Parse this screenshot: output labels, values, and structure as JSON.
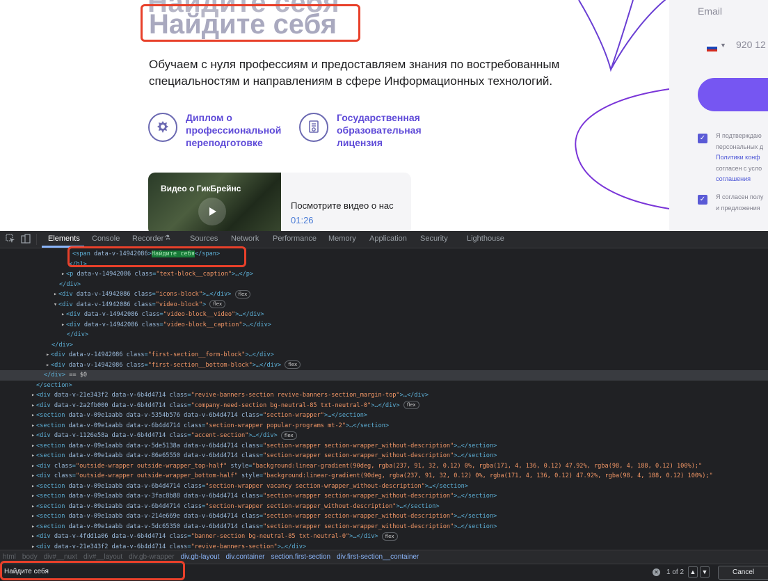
{
  "webpage": {
    "heading": "Найдите себя",
    "heading_above_cut": "Найдите себя",
    "caption_line1": "Обучаем с нуля профессиям и предоставляем знания по востребованным",
    "caption_line2": "специальностям и направлениям в сфере Информационных технологий.",
    "icons": [
      {
        "icon": "emblem-icon",
        "line1": "Диплом о",
        "line2": "профессиональной",
        "line3": "переподготовке"
      },
      {
        "icon": "license-certificate-icon",
        "line1": "Государственная",
        "line2": "образовательная",
        "line3": "лицензия"
      }
    ],
    "video": {
      "thumb_title": "Видео о ГикБрейнс",
      "caption": "Посмотрите видео о нас",
      "duration": "01:26"
    },
    "form": {
      "email_placeholder": "Email",
      "phone_placeholder": "920 12",
      "consent1": [
        "Я подтверждаю",
        "персональных д",
        "Политики конф",
        "согласен с усло",
        "соглашения"
      ],
      "consent2": [
        "Я согласен полу",
        "и предложения"
      ]
    }
  },
  "devtools": {
    "tabs": [
      "Elements",
      "Console",
      "Recorder",
      "Sources",
      "Network",
      "Performance",
      "Memory",
      "Application",
      "Security",
      "Lighthouse"
    ],
    "active_tab": "Elements",
    "recorder_icon": "flask-icon",
    "search": {
      "query": "Найдите себя",
      "match_count": "1 of 2",
      "cancel": "Cancel"
    },
    "breadcrumbs": [
      "html",
      "body",
      "div#__nuxt",
      "div#__layout",
      "div.gb-wrapper",
      "div.gb-layout",
      "div.container",
      "section.first-section",
      "div.first-section__container"
    ],
    "tree": {
      "l1": {
        "open": "<span ",
        "attr": "data-v-14942086",
        "gt": ">",
        "text": "Найдите себя",
        "close": "</span>"
      },
      "l2": "</h1>",
      "l3": {
        "open": "<p ",
        "attrs": "data-v-14942086 ",
        "cls_name": "class",
        "cls_val": "\"text-block__caption\"",
        "end": ">…</p>"
      },
      "l4": "</div>",
      "l5": {
        "open": "<div ",
        "attrs": "data-v-14942086 ",
        "cls_name": "class",
        "cls_val": "\"icons-block\"",
        "end": ">…</div>",
        "badge": "flex"
      },
      "l6": {
        "open": "<div ",
        "attrs": "data-v-14942086 ",
        "cls_name": "class",
        "cls_val": "\"video-block\"",
        "end": ">",
        "badge": "flex"
      },
      "l7": {
        "open": "<div ",
        "attrs": "data-v-14942086 ",
        "cls_name": "class",
        "cls_val": "\"video-block__video\"",
        "end": ">…</div>"
      },
      "l8": {
        "open": "<div ",
        "attrs": "data-v-14942086 ",
        "cls_name": "class",
        "cls_val": "\"video-block__caption\"",
        "end": ">…</div>"
      },
      "l9": "</div>",
      "l10": "</div>",
      "l11": {
        "open": "<div ",
        "attrs": "data-v-14942086 ",
        "cls_name": "class",
        "cls_val": "\"first-section__form-block\"",
        "end": ">…</div>"
      },
      "l12": {
        "open": "<div ",
        "attrs": "data-v-14942086 ",
        "cls_name": "class",
        "cls_val": "\"first-section__bottom-block\"",
        "end": ">…</div>",
        "badge": "flex"
      },
      "l13": {
        "tag": "</div>",
        "eq": " == $0"
      },
      "l14": "</section>",
      "l15": {
        "open": "<div ",
        "attrs": "data-v-21e343f2 data-v-6b4d4714 ",
        "cls_name": "class",
        "cls_val": "\"revive-banners-section revive-banners-section_margin-top\"",
        "end": ">…</div>"
      },
      "l16": {
        "open": "<div ",
        "attrs": "data-v-2a2fb000 data-v-6b4d4714 ",
        "cls_name": "class",
        "cls_val": "\"company-need-section bg-neutral-85 txt-neutral-0\"",
        "end": ">…</div>",
        "badge": "flex"
      },
      "l17": {
        "open": "<section ",
        "attrs": "data-v-09e1aabb data-v-5354b576 data-v-6b4d4714 ",
        "cls_name": "class",
        "cls_val": "\"section-wrapper\"",
        "end": ">…</section>"
      },
      "l18": {
        "open": "<section ",
        "attrs": "data-v-09e1aabb data-v-6b4d4714 ",
        "cls_name": "class",
        "cls_val": "\"section-wrapper popular-programs mt-2\"",
        "end": ">…</section>"
      },
      "l19": {
        "open": "<div ",
        "attrs": "data-v-1126e58a data-v-6b4d4714 ",
        "cls_name": "class",
        "cls_val": "\"accent-section\"",
        "end": ">…</div>",
        "badge": "flex"
      },
      "l20": {
        "open": "<section ",
        "attrs": "data-v-09e1aabb data-v-5de5138a data-v-6b4d4714 ",
        "cls_name": "class",
        "cls_val": "\"section-wrapper section-wrapper_without-description\"",
        "end": ">…</section>"
      },
      "l21": {
        "open": "<section ",
        "attrs": "data-v-09e1aabb data-v-86e65550 data-v-6b4d4714 ",
        "cls_name": "class",
        "cls_val": "\"section-wrapper section-wrapper_without-description\"",
        "end": ">…</section>"
      },
      "l22": {
        "open": "<div ",
        "attrs": "",
        "cls_name": "class",
        "cls_val": "\"outside-wrapper outside-wrapper_top-half\"",
        "style_name": " style",
        "style_val": "\"background:linear-gradient(90deg, rgba(237, 91, 32, 0.12) 0%, rgba(171, 4, 136, 0.12) 47.92%, rgba(98, 4, 188, 0.12) 100%);\""
      },
      "l23": {
        "open": "<div ",
        "attrs": "",
        "cls_name": "class",
        "cls_val": "\"outside-wrapper outside-wrapper_bottom-half\"",
        "style_name": " style",
        "style_val": "\"background:linear-gradient(90deg, rgba(237, 91, 32, 0.12) 0%, rgba(171, 4, 136, 0.12) 47.92%, rgba(98, 4, 188, 0.12) 100%);\""
      },
      "l24": {
        "open": "<section ",
        "attrs": "data-v-09e1aabb data-v-6b4d4714 ",
        "cls_name": "class",
        "cls_val": "\"section-wrapper vacancy section-wrapper_without-description\"",
        "end": ">…</section>"
      },
      "l25": {
        "open": "<section ",
        "attrs": "data-v-09e1aabb data-v-3fac8b88 data-v-6b4d4714 ",
        "cls_name": "class",
        "cls_val": "\"section-wrapper section-wrapper_without-description\"",
        "end": ">…</section>"
      },
      "l26": {
        "open": "<section ",
        "attrs": "data-v-09e1aabb data-v-6b4d4714 ",
        "cls_name": "class",
        "cls_val": "\"section-wrapper section-wrapper_without-description\"",
        "end": ">…</section>"
      },
      "l27": {
        "open": "<section ",
        "attrs": "data-v-09e1aabb data-v-214e669e data-v-6b4d4714 ",
        "cls_name": "class",
        "cls_val": "\"section-wrapper section-wrapper_without-description\"",
        "end": ">…</section>"
      },
      "l28": {
        "open": "<section ",
        "attrs": "data-v-09e1aabb data-v-5dc65350 data-v-6b4d4714 ",
        "cls_name": "class",
        "cls_val": "\"section-wrapper section-wrapper_without-description\"",
        "end": ">…</section>"
      },
      "l29": {
        "open": "<div ",
        "attrs": "data-v-4fdd1a06 data-v-6b4d4714 ",
        "cls_name": "class",
        "cls_val": "\"banner-section bg-neutral-85 txt-neutral-0\"",
        "end": ">…</div>",
        "badge": "flex"
      },
      "l30": {
        "open": "<div ",
        "attrs": "data-v-21e343f2 data-v-6b4d4714 ",
        "cls_name": "class",
        "cls_val": "\"revive-banners-section\"",
        "end": ">…</div>"
      }
    }
  },
  "colors": {
    "annotation_red": "#e8402a",
    "brand_purple": "#7656f2",
    "devtools_bg": "#202124",
    "search_highlight": "#177b38"
  }
}
